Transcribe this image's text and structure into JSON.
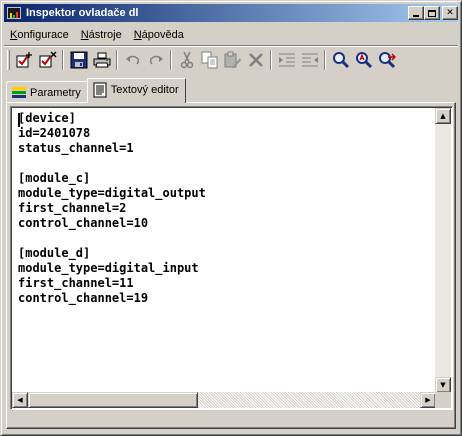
{
  "window": {
    "title": "Inspektor ovladače dl",
    "minimize_icon": "minimize-icon",
    "maximize_icon": "maximize-icon",
    "close_label": "✕"
  },
  "menu": {
    "items": [
      {
        "hotkey": "K",
        "rest": "onfigurace"
      },
      {
        "hotkey": "N",
        "rest": "ástroje"
      },
      {
        "hotkey": "N",
        "rest": "ápověda"
      }
    ]
  },
  "toolbar": {
    "icons": [
      "check-new-icon",
      "check-delete-icon",
      "save-icon",
      "print-icon",
      "undo-icon",
      "redo-icon",
      "cut-icon",
      "copy-icon",
      "paste-icon",
      "delete-icon",
      "indent-icon",
      "outdent-icon",
      "search-icon",
      "find-next-icon",
      "find-replace-icon"
    ]
  },
  "tabs": [
    {
      "label": "Parametry",
      "icon": "parameters-icon",
      "active": false
    },
    {
      "label": "Textový editor",
      "icon": "text-document-icon",
      "active": true
    }
  ],
  "editor": {
    "text": "[device]\nid=2401078\nstatus_channel=1\n\n[module_c]\nmodule_type=digital_output\nfirst_channel=2\ncontrol_channel=10\n\n[module_d]\nmodule_type=digital_input\nfirst_channel=11\ncontrol_channel=19"
  },
  "colors": {
    "title_gradient_start": "#0a246a",
    "title_gradient_end": "#a6caf0",
    "face": "#d4d0c8"
  }
}
